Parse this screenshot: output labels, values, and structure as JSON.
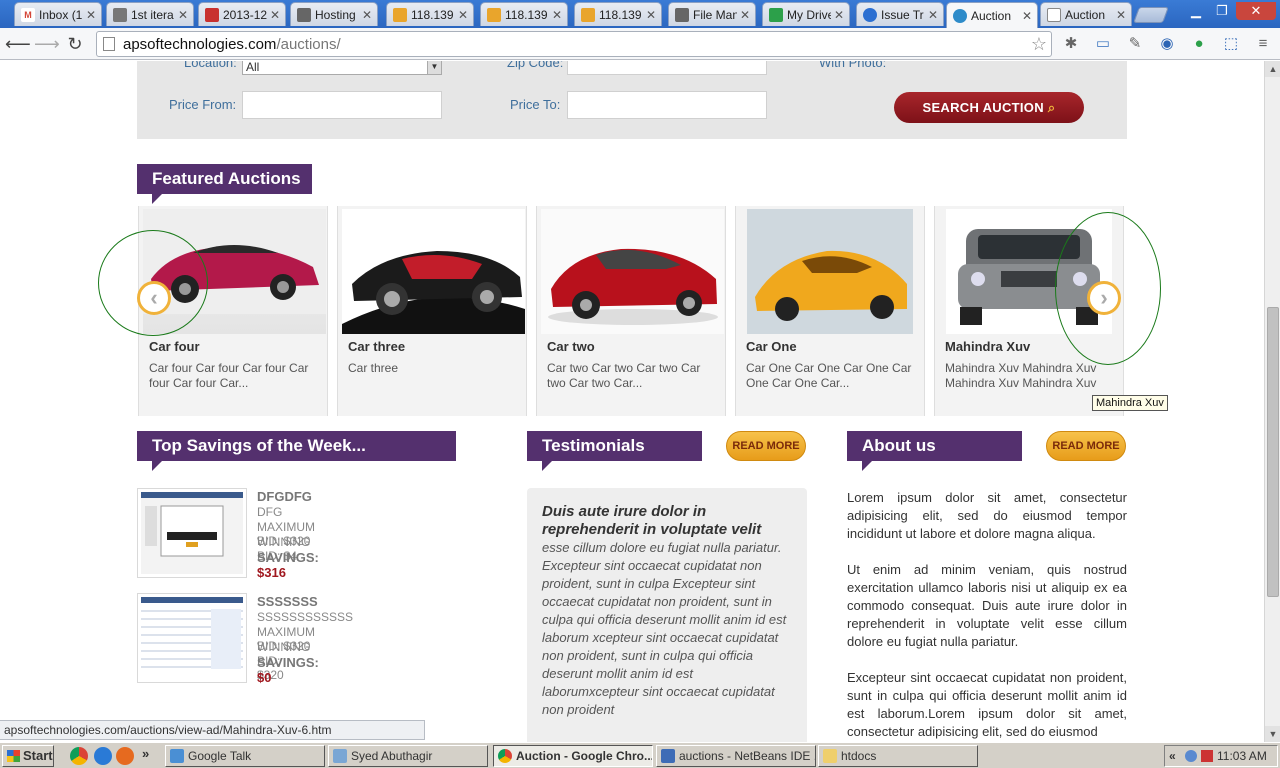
{
  "browser": {
    "tabs": [
      {
        "label": "Inbox (1",
        "fav_color": "#d44638",
        "glyph": "M"
      },
      {
        "label": "1st itera",
        "fav_color": "#777777",
        "glyph": ""
      },
      {
        "label": "2013-12",
        "fav_color": "#c8312f",
        "glyph": ""
      },
      {
        "label": "Hosting",
        "fav_color": "#666666",
        "glyph": ""
      },
      {
        "label": "118.139",
        "fav_color": "#e9a52c",
        "glyph": ""
      },
      {
        "label": "118.139",
        "fav_color": "#e9a52c",
        "glyph": ""
      },
      {
        "label": "118.139",
        "fav_color": "#e9a52c",
        "glyph": ""
      },
      {
        "label": "File Man",
        "fav_color": "#666666",
        "glyph": ""
      },
      {
        "label": "My Drive",
        "fav_color": "#2ca04a",
        "glyph": ""
      },
      {
        "label": "Issue Tr",
        "fav_color": "#2c6fd1",
        "glyph": ""
      },
      {
        "label": "Auction",
        "fav_color": "#2e8bc9",
        "glyph": ""
      },
      {
        "label": "Auction",
        "fav_color": "#eeeeee",
        "glyph": ""
      }
    ],
    "active_tab_index": 10,
    "url_host": "apsoftechnologies.com",
    "url_path": "/auctions/",
    "status_url": "apsoftechnologies.com/auctions/view-ad/Mahindra-Xuv-6.htm"
  },
  "search": {
    "location_label": "Location:",
    "location_value": "All",
    "zip_label": "Zip Code:",
    "photo_label": "With Photo:",
    "price_from_label": "Price From:",
    "price_to_label": "Price To:",
    "button_label": "SEARCH AUCTION"
  },
  "featured": {
    "heading": "Featured Auctions",
    "tooltip": "Mahindra Xuv",
    "cards": [
      {
        "title": "Car four",
        "desc": "Car four Car four Car four Car four Car four Car...",
        "color": "#b3194a"
      },
      {
        "title": "Car three",
        "desc": "Car three",
        "color": "#c21d2a"
      },
      {
        "title": "Car two",
        "desc": "Car two Car two Car two Car two Car two Car...",
        "color": "#b8111c"
      },
      {
        "title": "Car One",
        "desc": "Car One Car One Car One Car One Car One Car...",
        "color": "#f0a81d"
      },
      {
        "title": "Mahindra Xuv",
        "desc": "Mahindra Xuv Mahindra Xuv Mahindra Xuv Mahindra Xuv",
        "color": "#8a8d90"
      }
    ]
  },
  "savings": {
    "heading": "Top Savings of the Week...",
    "items": [
      {
        "title": "DFGDFG",
        "sub": "DFG",
        "max_bid": "MAXIMUM BID: $320",
        "win_bid": "WINNING BID: $4",
        "savings_label": "SAVINGS:",
        "savings_value": "$316"
      },
      {
        "title": "SSSSSSS",
        "sub": "SSSSSSSSSSSS",
        "max_bid": "MAXIMUM BID: $320",
        "win_bid": "WINNING BID: $320",
        "savings_label": "SAVINGS:",
        "savings_value": "$0"
      }
    ]
  },
  "testimonials": {
    "heading": "Testimonials",
    "read_more": "READ MORE",
    "lead": "Duis aute irure dolor in reprehenderit in voluptate velit",
    "body": "esse cillum dolore eu fugiat nulla pariatur. Excepteur sint occaecat cupidatat non proident, sunt in culpa Excepteur sint occaecat cupidatat non proident, sunt in culpa qui officia deserunt mollit anim id est laborum xcepteur sint occaecat cupidatat non proident, sunt in culpa qui officia deserunt mollit anim id est laborumxcepteur sint occaecat cupidatat non proident"
  },
  "about": {
    "heading": "About us",
    "read_more": "READ MORE",
    "p1": "Lorem ipsum dolor sit amet, consectetur adipisicing elit, sed do eiusmod tempor incididunt ut labore et dolore magna aliqua.",
    "p2": "Ut enim ad minim veniam, quis nostrud exercitation ullamco laboris nisi ut aliquip ex ea commodo consequat. Duis aute irure dolor in reprehenderit in voluptate velit esse cillum dolore eu fugiat nulla pariatur.",
    "p3": "Excepteur sint occaecat cupidatat non proident, sunt in culpa qui officia deserunt mollit anim id est laborum.Lorem ipsum dolor sit amet, consectetur adipisicing elit, sed do eiusmod"
  },
  "taskbar": {
    "start": "Start",
    "more": "»",
    "items": [
      {
        "label": "Google Talk",
        "active": false
      },
      {
        "label": "Syed Abuthagir",
        "active": false
      },
      {
        "label": "Auction - Google Chro...",
        "active": true
      },
      {
        "label": "auctions - NetBeans IDE ...",
        "active": false
      },
      {
        "label": "htdocs",
        "active": false
      }
    ],
    "tray_chevron": "«",
    "time": "11:03 AM"
  }
}
